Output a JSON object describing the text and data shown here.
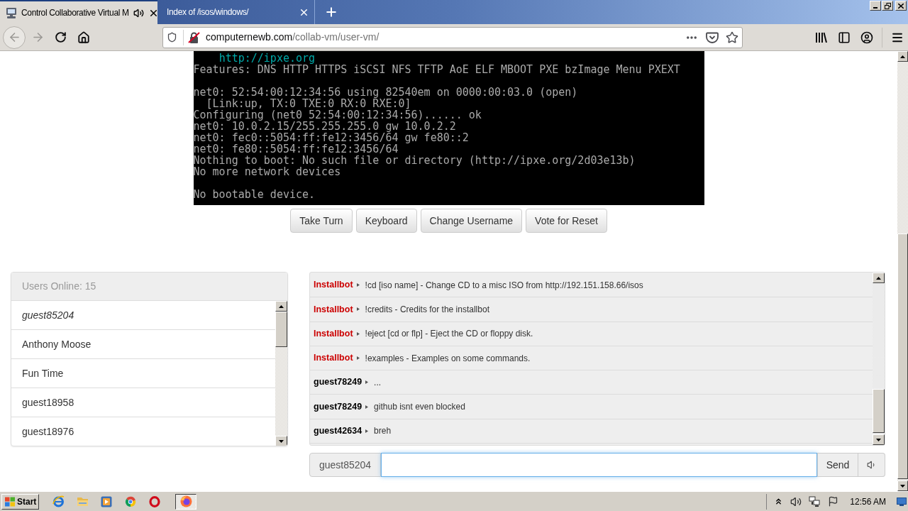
{
  "browser": {
    "tabs": [
      {
        "title": "Control Collaborative Virtual M",
        "selected": true,
        "audio": true
      },
      {
        "title": "Index of /isos/windows/",
        "selected": false,
        "audio": false
      }
    ],
    "nav": {
      "back_enabled": false,
      "forward_enabled": false
    },
    "address": {
      "domain": "computernewb.com",
      "path": "/collab-vm/user-vm/",
      "secure": false
    }
  },
  "vm_screen": {
    "blocks": [
      {
        "lines": [
          {
            "text": "    http://ipxe.org",
            "color": "#00aaaa"
          },
          {
            "text": "Features: DNS HTTP HTTPS iSCSI NFS TFTP AoE ELF MBOOT PXE bzImage Menu PXEXT",
            "color": "#aaaaaa"
          }
        ]
      },
      {
        "lines": [
          {
            "text": "net0: 52:54:00:12:34:56 using 82540em on 0000:00:03.0 (open)",
            "color": "#aaaaaa"
          },
          {
            "text": "  [Link:up, TX:0 TXE:0 RX:0 RXE:0]",
            "color": "#aaaaaa"
          },
          {
            "text": "Configuring (net0 52:54:00:12:34:56)...... ok",
            "color": "#aaaaaa"
          },
          {
            "text": "net0: 10.0.2.15/255.255.255.0 gw 10.0.2.2",
            "color": "#aaaaaa"
          },
          {
            "text": "net0: fec0::5054:ff:fe12:3456/64 gw fe80::2",
            "color": "#aaaaaa"
          },
          {
            "text": "net0: fe80::5054:ff:fe12:3456/64",
            "color": "#aaaaaa"
          },
          {
            "text": "Nothing to boot: No such file or directory (http://ipxe.org/2d03e13b)",
            "color": "#aaaaaa"
          },
          {
            "text": "No more network devices",
            "color": "#aaaaaa"
          }
        ]
      },
      {
        "lines": [
          {
            "text": "No bootable device.",
            "color": "#aaaaaa"
          }
        ]
      }
    ]
  },
  "vm_controls": [
    "Take Turn",
    "Keyboard",
    "Change Username",
    "Vote for Reset"
  ],
  "users": {
    "header": "Users Online: 15",
    "items": [
      {
        "name": "guest85204",
        "current": true
      },
      {
        "name": "Anthony Moose",
        "current": false
      },
      {
        "name": "Fun Time",
        "current": false
      },
      {
        "name": "guest18958",
        "current": false
      },
      {
        "name": "guest18976",
        "current": false
      }
    ]
  },
  "chat": {
    "messages": [
      {
        "user": "Installbot",
        "color": "#cc0000",
        "text": "!cd [iso name] - Change CD to a misc ISO from http://192.151.158.66/isos"
      },
      {
        "user": "Installbot",
        "color": "#cc0000",
        "text": "!credits - Credits for the installbot"
      },
      {
        "user": "Installbot",
        "color": "#cc0000",
        "text": "!eject [cd or flp] - Eject the CD or floppy disk."
      },
      {
        "user": "Installbot",
        "color": "#cc0000",
        "text": "!examples - Examples on some commands."
      },
      {
        "user": "guest78249",
        "color": "#000000",
        "text": "..."
      },
      {
        "user": "guest78249",
        "color": "#000000",
        "text": "github isnt even blocked"
      },
      {
        "user": "guest42634",
        "color": "#000000",
        "text": "breh"
      }
    ],
    "username": "guest85204",
    "input_focused": true,
    "send": "Send"
  },
  "taskbar": {
    "start": "Start",
    "apps": [
      {
        "kind": "ie",
        "active": false
      },
      {
        "kind": "explorer",
        "active": false
      },
      {
        "kind": "media-player",
        "active": false
      },
      {
        "kind": "chrome",
        "active": false
      },
      {
        "kind": "opera",
        "active": false
      },
      {
        "kind": "firefox",
        "active": true
      }
    ],
    "clock": "12:56 AM"
  }
}
